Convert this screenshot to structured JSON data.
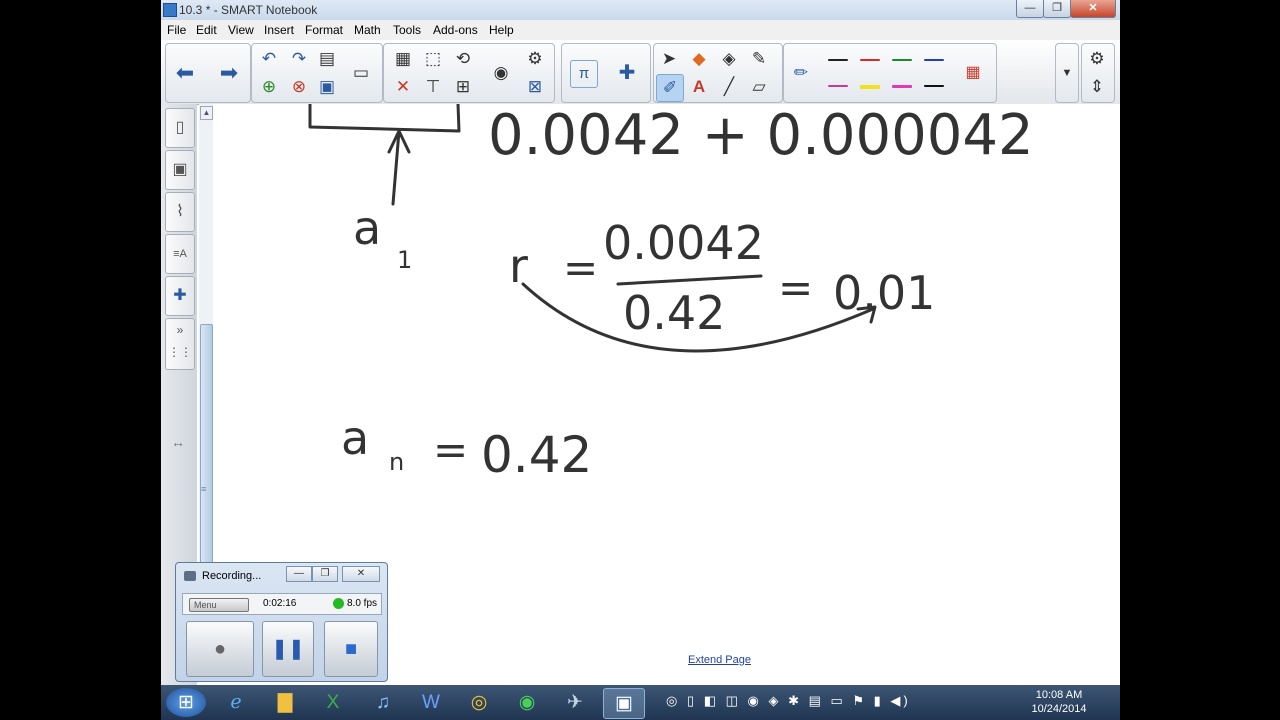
{
  "window": {
    "title": "10.3 * - SMART Notebook",
    "controls": {
      "minimize": "—",
      "maximize": "❐",
      "close": "✕"
    }
  },
  "menu": [
    "File",
    "Edit",
    "View",
    "Insert",
    "Format",
    "Math",
    "Tools",
    "Add-ons",
    "Help"
  ],
  "pen_colors": [
    "#222222",
    "#d42a2a",
    "#1d8a2a",
    "#2440b5",
    "#c43aa0",
    "#f2e21d",
    "#e03ab8",
    "#111111"
  ],
  "canvas": {
    "equations": {
      "top_terms": "0.0042 + 0.000042",
      "first_term_label": "a",
      "first_term_sub": "1",
      "ratio_r": "r",
      "ratio_eq1": "=",
      "ratio_num": "0.0042",
      "ratio_den": "0.42",
      "ratio_eq2": "=",
      "ratio_result": "0.01",
      "an_label": "a",
      "an_sub": "n",
      "an_eq": "=",
      "an_value": "0.42"
    },
    "extend_page": "Extend Page"
  },
  "recorder": {
    "title": "Recording...",
    "minimize": "—",
    "restore": "❐",
    "close": "✕",
    "menu_label": "Menu",
    "elapsed": "0:02:16",
    "fps": "8.0 fps"
  },
  "clock": {
    "time": "10:08 AM",
    "date": "10/24/2014"
  }
}
